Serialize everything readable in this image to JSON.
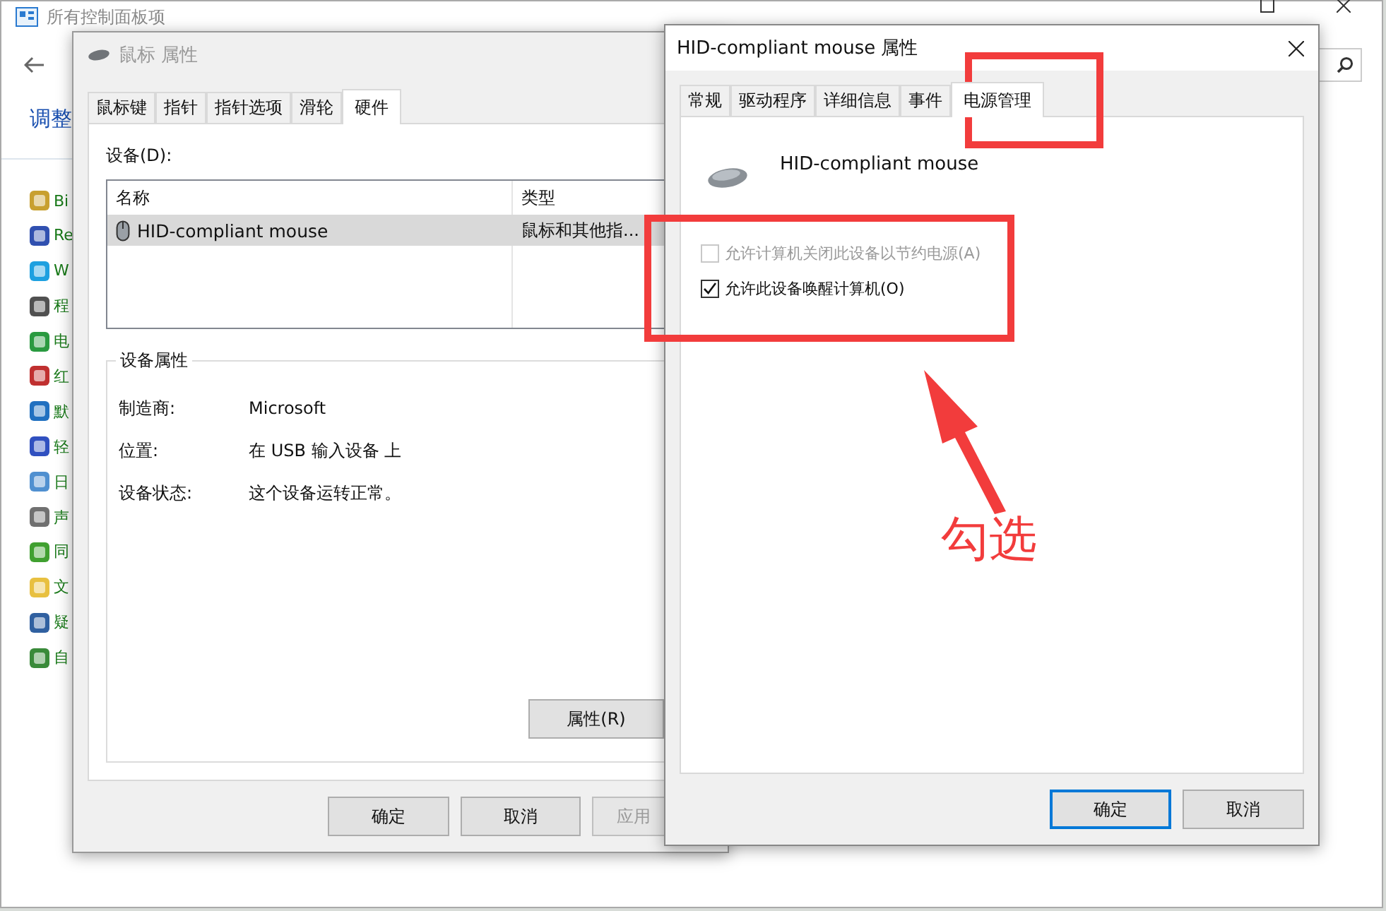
{
  "background_window": {
    "title": "所有控制面板项",
    "heading": "调整",
    "sidebar": {
      "items": [
        {
          "label": "Bi"
        },
        {
          "label": "Re"
        },
        {
          "label": "W"
        },
        {
          "label": "程"
        },
        {
          "label": "电"
        },
        {
          "label": "红"
        },
        {
          "label": "默"
        },
        {
          "label": "轻"
        },
        {
          "label": "日"
        },
        {
          "label": "声"
        },
        {
          "label": "同"
        },
        {
          "label": "文"
        },
        {
          "label": "疑"
        },
        {
          "label": "自"
        }
      ]
    }
  },
  "mouse_dialog": {
    "title": "鼠标 属性",
    "tabs": [
      {
        "label": "鼠标键",
        "selected": false
      },
      {
        "label": "指针",
        "selected": false
      },
      {
        "label": "指针选项",
        "selected": false
      },
      {
        "label": "滑轮",
        "selected": false
      },
      {
        "label": "硬件",
        "selected": true
      }
    ],
    "device_label": "设备(D):",
    "list": {
      "columns": [
        "名称",
        "类型"
      ],
      "rows": [
        {
          "name": "HID-compliant mouse",
          "type": "鼠标和其他指...",
          "selected": true
        }
      ]
    },
    "properties_group": {
      "title": "设备属性",
      "rows": [
        {
          "label": "制造商:",
          "value": "Microsoft"
        },
        {
          "label": "位置:",
          "value": "在 USB 输入设备 上"
        },
        {
          "label": "设备状态:",
          "value": "这个设备运转正常。"
        }
      ]
    },
    "properties_button": "属性(R)",
    "buttons": [
      {
        "label": "确定",
        "disabled": false
      },
      {
        "label": "取消",
        "disabled": false
      },
      {
        "label": "应用",
        "disabled": true
      }
    ]
  },
  "hid_dialog": {
    "title": "HID-compliant mouse 属性",
    "tabs": [
      {
        "label": "常规",
        "selected": false
      },
      {
        "label": "驱动程序",
        "selected": false
      },
      {
        "label": "详细信息",
        "selected": false
      },
      {
        "label": "事件",
        "selected": false
      },
      {
        "label": "电源管理",
        "selected": true
      }
    ],
    "device_name": "HID-compliant mouse",
    "options": [
      {
        "label": "允许计算机关闭此设备以节约电源(A)",
        "checked": false,
        "disabled": true
      },
      {
        "label": "允许此设备唤醒计算机(O)",
        "checked": true,
        "disabled": false
      }
    ],
    "buttons": [
      {
        "label": "确定",
        "default": true
      },
      {
        "label": "取消",
        "default": false
      }
    ]
  },
  "annotation": {
    "text": "勾选"
  }
}
